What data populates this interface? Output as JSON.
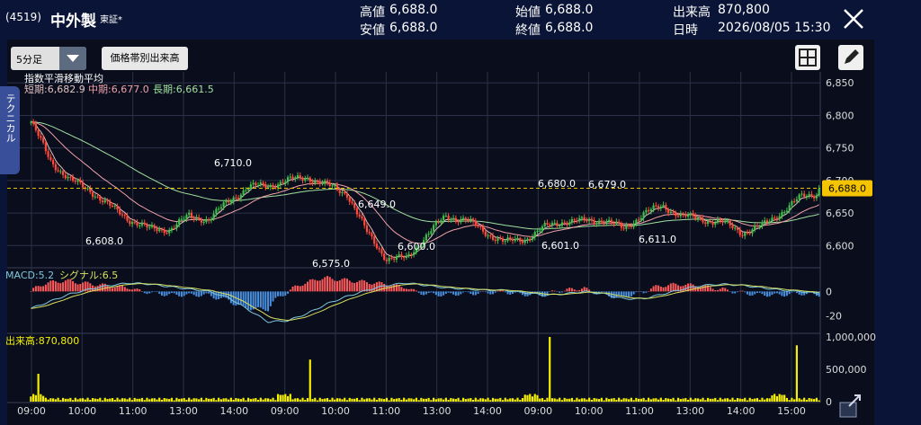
{
  "header": {
    "code": "(4519)",
    "name": "中外製",
    "exchange": "東証*",
    "high_label": "高値",
    "high_value": "6,688.0",
    "low_label": "安値",
    "low_value": "6,688.0",
    "open_label": "始値",
    "open_value": "6,688.0",
    "close_label": "終値",
    "close_value": "6,688.0",
    "volume_label": "出来高",
    "volume_value": "870,800",
    "datetime_label": "日時",
    "datetime_value": "2026/08/05 15:30"
  },
  "toolbar": {
    "timeframe": "5分足",
    "price_volume_button": "価格帯別出来高",
    "side_tab": "テクニカル"
  },
  "colors": {
    "up": "#3ec04a",
    "down": "#ff4a3a",
    "short_ma": "#e0c0c0",
    "mid_ma": "#f0a0a8",
    "long_ma": "#a0e0a0",
    "macd": "#7ec8e0",
    "signal": "#d8e060",
    "volume": "#f5f000",
    "hist_pos": "#ff5a5a",
    "hist_neg": "#4a90e0"
  },
  "chart_data": {
    "type": "candlestick",
    "ma_title": "指数平滑移動平均",
    "ma_legend": [
      {
        "label": "短期:6,682.9",
        "color": "#e0c0c0"
      },
      {
        "label": "中期:6,677.0",
        "color": "#f0a0a8"
      },
      {
        "label": "長期:6,661.5",
        "color": "#a0e0a0"
      }
    ],
    "price_axis": {
      "ylim": [
        6570,
        6860
      ],
      "ticks": [
        6600,
        6650,
        6700,
        6750,
        6800,
        6850
      ],
      "tick_labels": [
        "6,600",
        "6,650",
        "6,700",
        "6,750",
        "6,800",
        "6,850"
      ]
    },
    "current_price": {
      "value": 6688,
      "label": "6,688.0"
    },
    "x_tick_labels": [
      "09:00",
      "10:00",
      "11:00",
      "13:00",
      "14:00",
      "09:00",
      "10:00",
      "11:00",
      "13:00",
      "14:00",
      "09:00",
      "10:00",
      "11:00",
      "13:00",
      "14:00",
      "15:00"
    ],
    "price_path": [
      [
        6790,
        6810
      ],
      [
        6730,
        6720
      ],
      [
        6700,
        6680
      ],
      [
        6685,
        6650
      ],
      [
        6660,
        6650
      ],
      [
        6640,
        6630
      ],
      [
        6625,
        6610
      ],
      [
        6625,
        6630
      ],
      [
        6645,
        6650
      ],
      [
        6640,
        6660
      ],
      [
        6668,
        6680
      ],
      [
        6690,
        6692
      ],
      [
        6692,
        6698
      ],
      [
        6700,
        6710
      ],
      [
        6705,
        6700
      ],
      [
        6692,
        6690
      ],
      [
        6680,
        6678
      ],
      [
        6620,
        6600
      ],
      [
        6580,
        6575
      ],
      [
        6580,
        6590
      ],
      [
        6615,
        6635
      ],
      [
        6645,
        6649
      ],
      [
        6640,
        6630
      ],
      [
        6620,
        6610
      ],
      [
        6605,
        6600
      ],
      [
        6610,
        6620
      ],
      [
        6628,
        6635
      ],
      [
        6638,
        6640
      ],
      [
        6637,
        6642
      ],
      [
        6640,
        6640
      ],
      [
        6625,
        6645
      ],
      [
        6650,
        6655
      ],
      [
        6660,
        6650
      ],
      [
        6645,
        6640
      ],
      [
        6640,
        6635
      ],
      [
        6635,
        6625
      ],
      [
        6620,
        6615
      ],
      [
        6630,
        6645
      ],
      [
        6652,
        6665
      ],
      [
        6675,
        6680
      ],
      [
        6682,
        6688
      ]
    ],
    "annotations": [
      {
        "label": "6,608.0",
        "value": 6608
      },
      {
        "label": "6,710.0",
        "value": 6710
      },
      {
        "label": "6,575.0",
        "value": 6575
      },
      {
        "label": "6,649.0",
        "value": 6649
      },
      {
        "label": "6,600.0",
        "value": 6600
      },
      {
        "label": "6,601.0",
        "value": 6601
      },
      {
        "label": "6,680.0",
        "value": 6680
      },
      {
        "label": "6,679.0",
        "value": 6679
      },
      {
        "label": "6,611.0",
        "value": 6611
      }
    ],
    "macd": {
      "title": "MACD:5.2",
      "signal_title": "シグナル:6.5",
      "tick_labels": [
        "0",
        "-20"
      ],
      "ylim": [
        -30,
        18
      ],
      "path": [
        -14,
        -8,
        -2,
        2,
        5,
        7,
        6,
        4,
        2,
        0,
        -5,
        -15,
        -25,
        -24,
        -18,
        -10,
        -4,
        1,
        5,
        7,
        5,
        3,
        2,
        1,
        1,
        -1,
        -3,
        -2,
        0,
        -2,
        -6,
        -6,
        -2,
        2,
        5,
        6,
        5,
        3,
        1,
        0,
        -2
      ]
    },
    "volume": {
      "title": "出来高:870,800",
      "tick_labels": [
        "1,000,000",
        "500,000",
        "0"
      ],
      "ylim": [
        0,
        1000000
      ],
      "spikes": [
        {
          "idx": 3,
          "value": 430000
        },
        {
          "idx": 113,
          "value": 650000
        },
        {
          "idx": 210,
          "value": 1000000
        },
        {
          "idx": 310,
          "value": 870800
        }
      ]
    }
  }
}
